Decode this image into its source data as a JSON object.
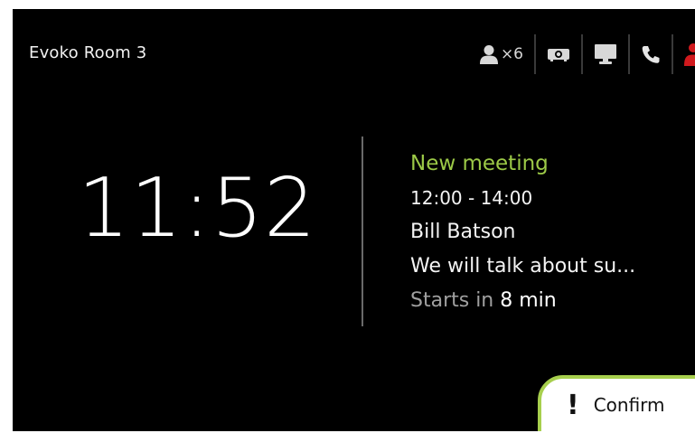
{
  "room": {
    "name": "Evoko Room 3"
  },
  "status_bar": {
    "capacity_icon": "person-icon",
    "capacity_text": "×6",
    "equipment": [
      {
        "icon": "projector-icon"
      },
      {
        "icon": "monitor-icon"
      },
      {
        "icon": "phone-icon"
      },
      {
        "icon": "person-red-icon"
      }
    ],
    "colors": {
      "icon": "#d8d8d8",
      "phone": "#e6e6e6",
      "alert": "#d0191d"
    }
  },
  "clock": {
    "time": "11:52"
  },
  "meeting": {
    "title": "New meeting",
    "time_range": "12:00 - 14:00",
    "organizer": "Bill Batson",
    "subject": "We will talk about su...",
    "starts_prefix": "Starts in",
    "starts_value": "8 min"
  },
  "confirm": {
    "icon": "exclamation-icon",
    "label": "Confirm"
  },
  "colors": {
    "background": "#000000",
    "accent_green": "#9cc947",
    "confirm_border": "#a7cf4d",
    "divider": "#6a6a6a"
  }
}
